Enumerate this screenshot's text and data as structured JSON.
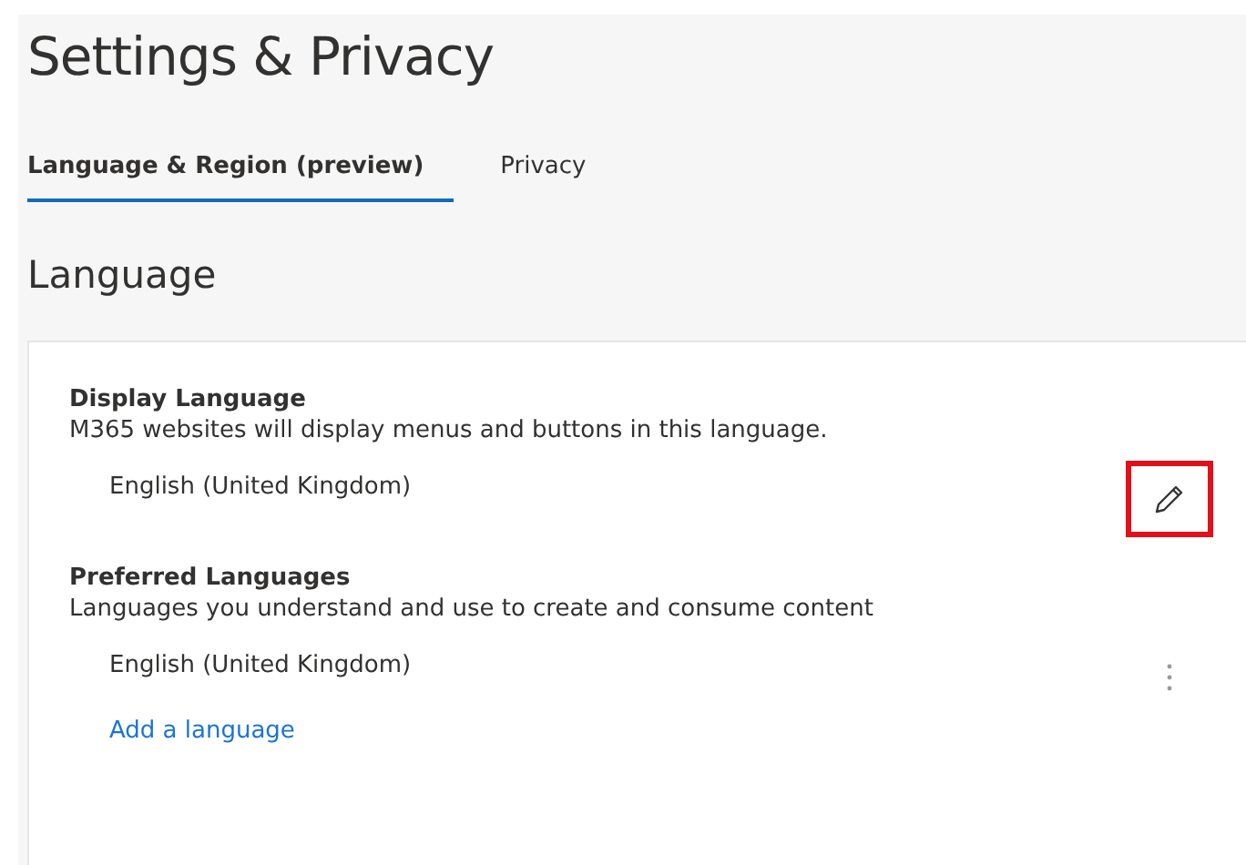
{
  "page": {
    "title": "Settings & Privacy"
  },
  "tabs": [
    {
      "label": "Language & Region (preview)",
      "selected": true
    },
    {
      "label": "Privacy",
      "selected": false
    }
  ],
  "section_heading": "Language",
  "groups": [
    {
      "kind": "edit",
      "title": "Display Language",
      "description": "M365 websites will display menus and buttons in this language.",
      "items": [
        {
          "label": "English (United Kingdom)",
          "highlighted": true
        }
      ]
    },
    {
      "kind": "list",
      "title": "Preferred Languages",
      "description": "Languages you understand and use to create and consume content",
      "items": [
        {
          "label": "English (United Kingdom)",
          "highlighted": false
        }
      ],
      "add_link": "Add a language"
    }
  ]
}
